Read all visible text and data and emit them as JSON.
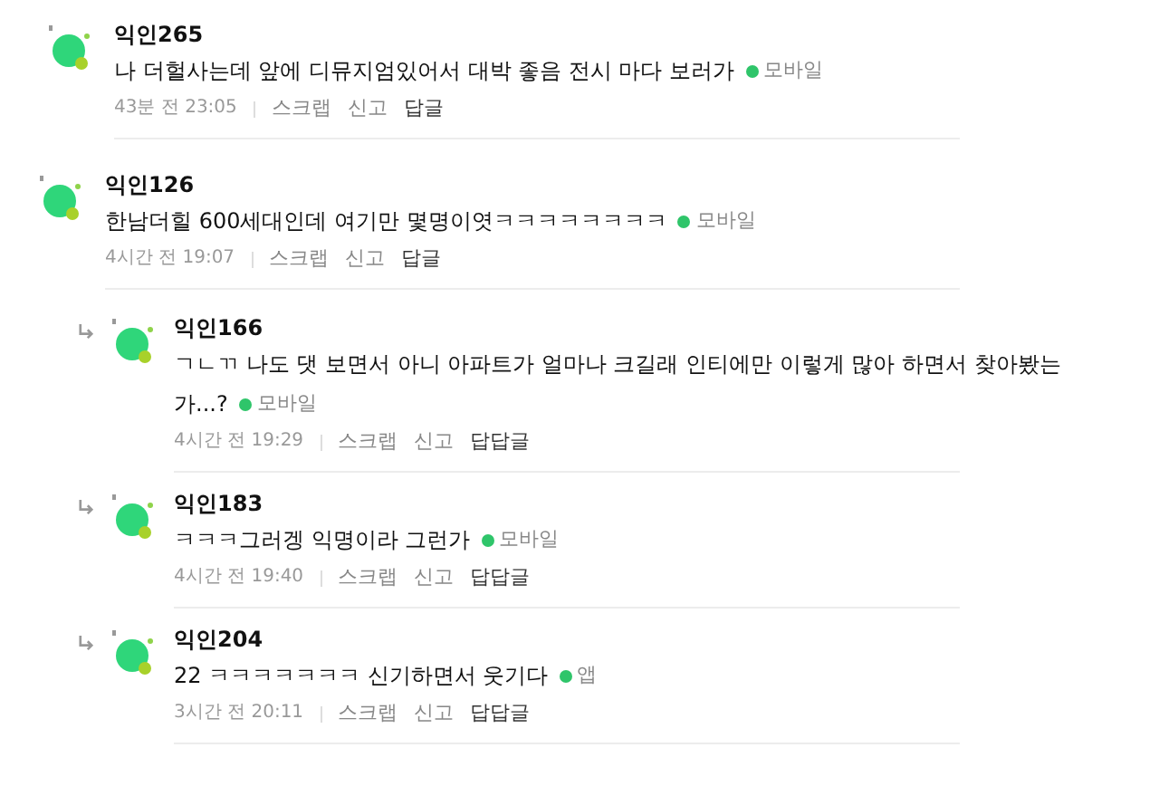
{
  "comments": [
    {
      "author": "익인265",
      "lines": [
        "나 더헐사는데 앞에 디뮤지엄있어서 대박 좋음 전시 마다 보러가"
      ],
      "platform": "모바일",
      "time": "43분 전 23:05",
      "actions": [
        "스크랩",
        "신고"
      ],
      "reply_label": "답글"
    },
    {
      "author": "익인126",
      "lines": [
        "한남더힐 600세대인데 여기만 몇명이엿ㅋㅋㅋㅋㅋㅋㅋㅋ"
      ],
      "platform": "모바일",
      "time": "4시간 전 19:07",
      "actions": [
        "스크랩",
        "신고"
      ],
      "reply_label": "답글",
      "children": [
        {
          "author": "익인166",
          "lines": [
            "ㄱㄴㄲ 나도 댓 보면서 아니 아파트가 얼마나 크길래 인티에만 이렇게 많아 하면서 찾아봤는",
            "가...?"
          ],
          "platform": "모바일",
          "time": "4시간 전 19:29",
          "actions": [
            "스크랩",
            "신고"
          ],
          "reply_label": "답답글"
        },
        {
          "author": "익인183",
          "lines": [
            "ㅋㅋㅋ그러겡 익명이라 그런가"
          ],
          "platform": "모바일",
          "time": "4시간 전 19:40",
          "actions": [
            "스크랩",
            "신고"
          ],
          "reply_label": "답답글"
        },
        {
          "author": "익인204",
          "lines": [
            "22 ㅋㅋㅋㅋㅋㅋㅋ 신기하면서 웃기다"
          ],
          "platform": "앱",
          "time": "3시간 전 20:11",
          "actions": [
            "스크랩",
            "신고"
          ],
          "reply_label": "답답글"
        }
      ]
    }
  ]
}
